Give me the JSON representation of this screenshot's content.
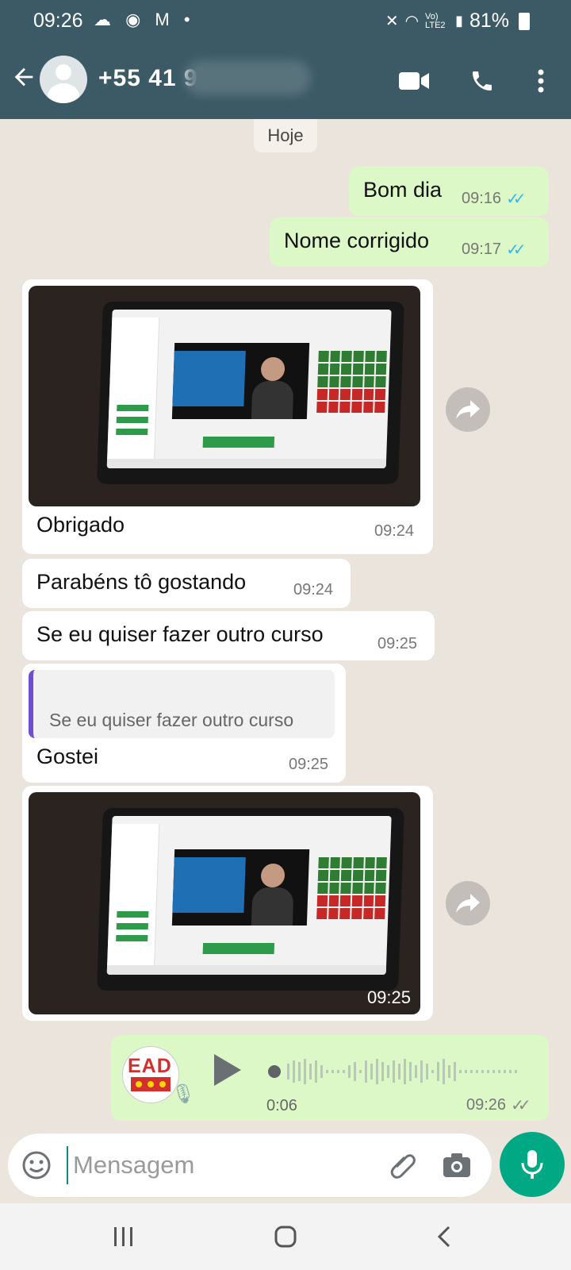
{
  "status_bar": {
    "time": "09:26",
    "network": "Vo) LTE2",
    "battery": "81%"
  },
  "header": {
    "contact_name": "+55 41 9",
    "icons": [
      "back-arrow-icon",
      "avatar-icon",
      "video-call-icon",
      "phone-icon",
      "more-vert-icon"
    ]
  },
  "chat": {
    "date_chip": "Hoje",
    "messages": [
      {
        "text": "Bom dia",
        "time": "09:16",
        "direction": "out",
        "read": true
      },
      {
        "text": "Nome corrigido",
        "time": "09:17",
        "direction": "out",
        "read": true
      },
      {
        "type": "image",
        "caption": "Obrigado",
        "time": "09:24",
        "direction": "in"
      },
      {
        "text": "Parabéns tô gostando",
        "time": "09:24",
        "direction": "in"
      },
      {
        "text": "Se eu quiser fazer outro curso",
        "time": "09:25",
        "direction": "in"
      },
      {
        "type": "reply",
        "quoted": "Se eu quiser fazer outro curso",
        "text": "Gostei",
        "time": "09:25",
        "direction": "in"
      },
      {
        "type": "image",
        "time": "09:25",
        "direction": "in"
      },
      {
        "type": "voice",
        "duration": "0:06",
        "time": "09:26",
        "direction": "out",
        "sender_logo": "EAD"
      }
    ]
  },
  "input": {
    "placeholder": "Mensagem"
  },
  "colors": {
    "header": "#3b5a66",
    "outgoing": "#dcf8c6",
    "incoming": "#ffffff",
    "accent": "#00a884",
    "ticks_read": "#34b7f1"
  }
}
